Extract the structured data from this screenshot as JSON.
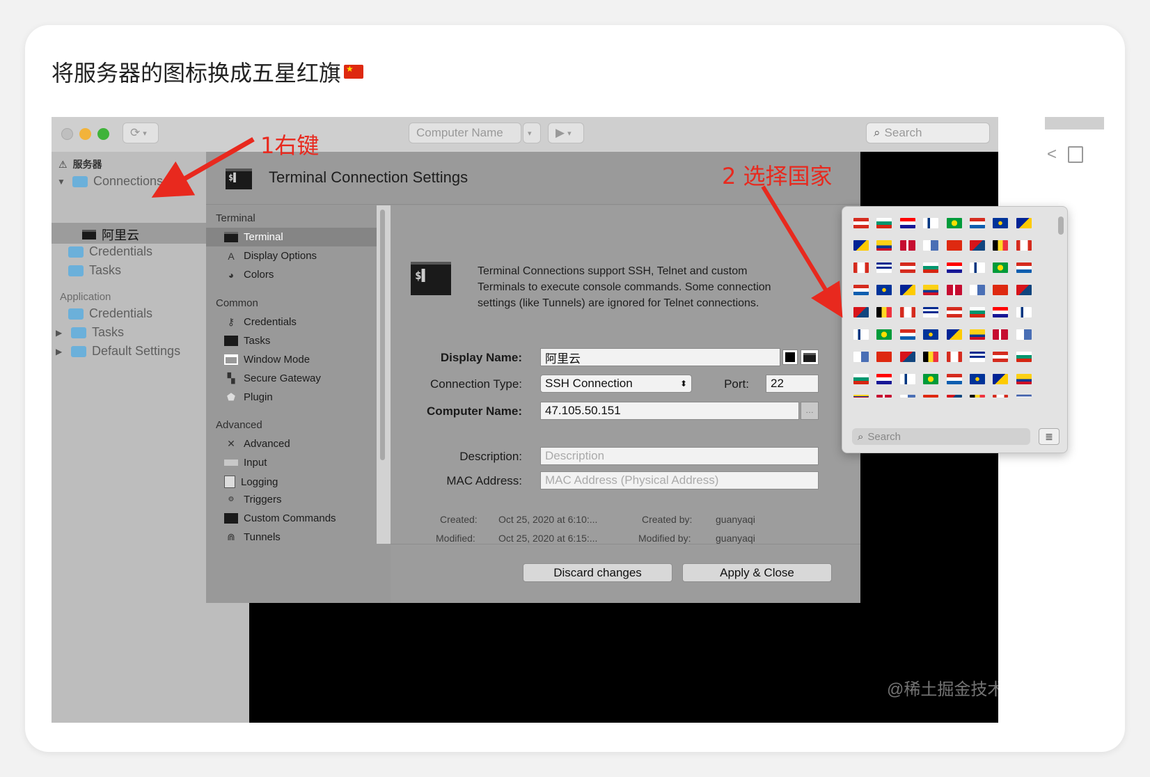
{
  "heading": "将服务器的图标换成五星红旗",
  "toolbar": {
    "computer_name_placeholder": "Computer Name",
    "search_placeholder": "Search"
  },
  "sidebar": {
    "server_group": "服务器",
    "connections": "Connections",
    "selected_connection": "阿里云",
    "credentials": "Credentials",
    "tasks": "Tasks",
    "application_section": "Application",
    "app_credentials": "Credentials",
    "app_tasks": "Tasks",
    "default_settings": "Default Settings"
  },
  "dialog": {
    "title": "Terminal Connection Settings",
    "nav": {
      "terminal_section": "Terminal",
      "terminal": "Terminal",
      "display_options": "Display Options",
      "colors": "Colors",
      "common_section": "Common",
      "credentials": "Credentials",
      "tasks": "Tasks",
      "window_mode": "Window Mode",
      "secure_gateway": "Secure Gateway",
      "plugin": "Plugin",
      "advanced_section": "Advanced",
      "advanced": "Advanced",
      "input": "Input",
      "logging": "Logging",
      "triggers": "Triggers",
      "custom_commands": "Custom Commands",
      "tunnels": "Tunnels"
    },
    "intro_text": "Terminal Connections support SSH, Telnet and custom Terminals to execute console commands. Some connection settings (like Tunnels) are ignored for Telnet connections.",
    "display_name_label": "Display Name:",
    "display_name_value": "阿里云",
    "connection_type_label": "Connection Type:",
    "connection_type_value": "SSH Connection",
    "port_label": "Port:",
    "port_value": "22",
    "computer_name_label": "Computer Name:",
    "computer_name_value": "47.105.50.151",
    "description_label": "Description:",
    "description_placeholder": "Description",
    "mac_label": "MAC Address:",
    "mac_placeholder": "MAC Address (Physical Address)",
    "created_label": "Created:",
    "created_value": "Oct 25, 2020 at 6:10:...",
    "modified_label": "Modified:",
    "modified_value": "Oct 25, 2020 at 6:15:...",
    "created_by_label": "Created by:",
    "created_by_value": "guanyaqi",
    "modified_by_label": "Modified by:",
    "modified_by_value": "guanyaqi",
    "discard_button": "Discard changes",
    "apply_button": "Apply & Close"
  },
  "icon_picker": {
    "search_placeholder": "Search"
  },
  "annotations": {
    "step1": "1右键",
    "step2": "2 选择国家"
  },
  "watermark": "@稀土掘金技术社区",
  "colors": {
    "annotation_red": "#e8291e",
    "folder_blue": "#6bb0da"
  }
}
